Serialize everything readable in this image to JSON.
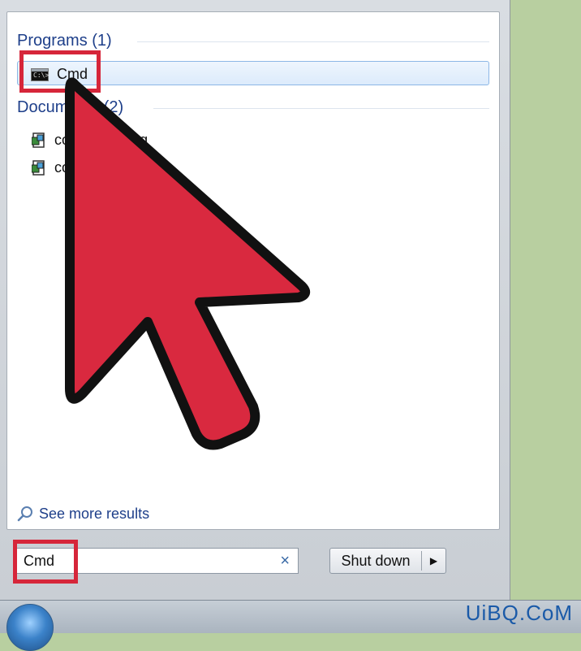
{
  "start_menu": {
    "programs_header": "Programs (1)",
    "programs": [
      {
        "label": "Cmd",
        "icon": "command-prompt-icon"
      }
    ],
    "documents_header": "Documents (2)",
    "documents": [
      {
        "label": "co 152535.reg",
        "icon": "registry-file-icon"
      },
      {
        "label": "co 016.reg",
        "icon": "registry-file-icon"
      }
    ],
    "see_more_label": "See more results",
    "search": {
      "value": "Cmd",
      "clear_icon": "×"
    },
    "shutdown_label": "Shut down",
    "shutdown_arrow": "▶"
  },
  "taskbar": {
    "start_button_icon": "windows-start-orb"
  },
  "watermark": "UiBQ.CoM",
  "colors": {
    "highlight": "#d6263a",
    "arrow_fill": "#d9293f",
    "header_blue": "#1e3f8a"
  }
}
